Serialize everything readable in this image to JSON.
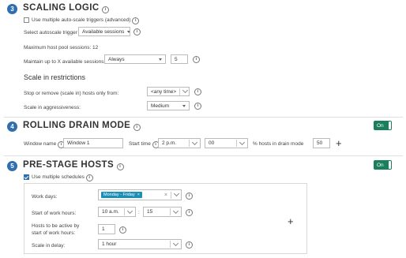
{
  "colors": {
    "step_badge": "#2f6fb0",
    "toggle_on": "#1a7f5a",
    "tag": "#1a8fb8"
  },
  "scaling": {
    "step": "3",
    "title": "SCALING LOGIC",
    "multi_triggers_label": "Use multiple auto-scale triggers (advanced)",
    "multi_triggers_checked": false,
    "trigger_label": "Select autoscale trigger",
    "trigger_value": "Available sessions",
    "max_sessions_text": "Maximum host pool sessions: 12",
    "maintain_label": "Maintain up to X available sessions:",
    "maintain_value": "Always",
    "maintain_count": "5",
    "restrictions_heading": "Scale in restrictions",
    "stop_label": "Stop or remove (scale in) hosts only from:",
    "stop_value": "<any time>",
    "aggr_label": "Scale in aggressiveness:",
    "aggr_value": "Medium"
  },
  "drain": {
    "step": "4",
    "title": "ROLLING DRAIN MODE",
    "toggle_label": "On",
    "window_label": "Window name",
    "window_value": "Window 1",
    "start_label": "Start time",
    "hour_value": "2 p.m.",
    "minute_value": "00",
    "pct_label": "% hosts in drain mode",
    "pct_value": "50"
  },
  "prestage": {
    "step": "5",
    "title": "PRE-STAGE HOSTS",
    "toggle_label": "On",
    "schedules_label": "Use multiple schedules",
    "schedules_checked": true,
    "workdays_label": "Work days:",
    "workdays_tag": "Monday - Friday",
    "start_label": "Start of work hours:",
    "start_hour": "10 a.m.",
    "start_sep": ":",
    "start_minute": "15",
    "hosts_label_1": "Hosts to be active by",
    "hosts_label_2": "start of work hours:",
    "hosts_value": "1",
    "delay_label": "Scale in delay:",
    "delay_value": "1 hour"
  },
  "icons": {
    "info": "i",
    "plus": "+",
    "tag_remove": "×",
    "clear": "×"
  }
}
